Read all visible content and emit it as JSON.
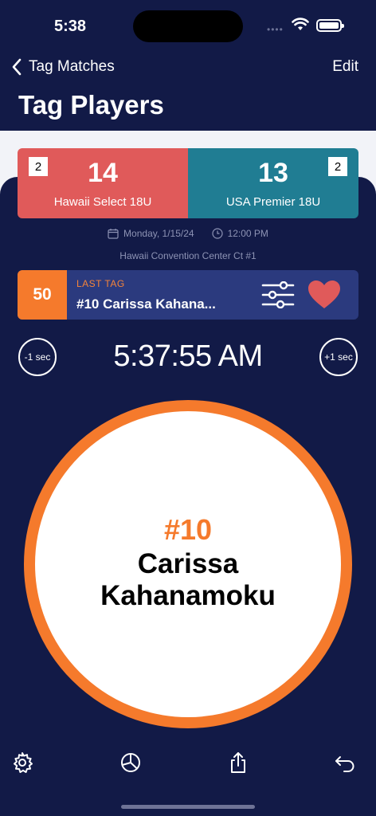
{
  "status_bar": {
    "time": "5:38"
  },
  "nav": {
    "back_label": "Tag Matches",
    "edit_label": "Edit"
  },
  "page": {
    "title": "Tag Players"
  },
  "match": {
    "home": {
      "score": "14",
      "name": "Hawaii Select 18U",
      "count": "2",
      "color": "#e05a5a"
    },
    "away": {
      "score": "13",
      "name": "USA Premier 18U",
      "count": "2",
      "color": "#207d93"
    },
    "date": "Monday, 1/15/24",
    "time": "12:00 PM",
    "venue": "Hawaii Convention Center Ct #1"
  },
  "last_tag": {
    "number": "50",
    "label": "LAST TAG",
    "player": "#10 Carissa Kahana..."
  },
  "clock": {
    "minus_label": "-1 sec",
    "value": "5:37:55 AM",
    "plus_label": "+1 sec"
  },
  "current_player": {
    "number": "#10",
    "name": "Carissa Kahanamoku"
  },
  "toolbar": {
    "icons": [
      "gear-icon",
      "pie-chart-icon",
      "share-icon",
      "undo-icon"
    ]
  },
  "colors": {
    "accent": "#f57a2c",
    "background": "#121a47",
    "heart": "#e05a5a"
  }
}
